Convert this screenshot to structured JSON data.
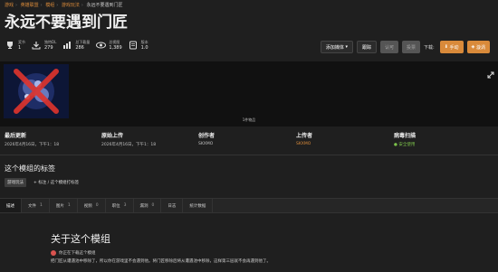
{
  "breadcrumb": [
    "游戏",
    "英雄联盟",
    "模组",
    "游戏玩法",
    "永远不要遇到门匠"
  ],
  "title": "永远不要遇到门匠",
  "stats": [
    {
      "icon": "trophy-icon",
      "label": "奖节",
      "value": "1"
    },
    {
      "icon": "download-icon",
      "label": "独特DL",
      "value": "279"
    },
    {
      "icon": "chart-icon",
      "label": "总下载量",
      "value": "286"
    },
    {
      "icon": "eye-icon",
      "label": "总视图",
      "value": "1,389"
    },
    {
      "icon": "version-icon",
      "label": "版本",
      "value": "1.0"
    }
  ],
  "actions": {
    "add_collection": "添加媒体",
    "tracking": "跟踪",
    "endorse": "认可",
    "vote": "投票",
    "download_label": "下载:",
    "manual": "手动",
    "vortex": "漩涡"
  },
  "hero": {
    "image_count": "1件物品"
  },
  "meta": {
    "last_updated": {
      "label": "最后更新",
      "value": "2026年4月16日，下午1：18"
    },
    "original_upload": {
      "label": "原始上传",
      "value": "2026年4月16日，下午1：18"
    },
    "created_by": {
      "label": "创作者",
      "value": "SKXMO"
    },
    "uploaded_by": {
      "label": "上传者",
      "value": "SKXMO"
    },
    "virus_scan": {
      "label": "病毒扫描",
      "value": "安全使用"
    }
  },
  "tags": {
    "heading": "这个模组的标签",
    "items": [
      "游戏玩法"
    ],
    "add_label": "+ 标注 / 这个模组打标签"
  },
  "tabs": [
    {
      "label": "描述",
      "count": ""
    },
    {
      "label": "文件",
      "count": "1"
    },
    {
      "label": "图片",
      "count": "1"
    },
    {
      "label": "视频",
      "count": "0"
    },
    {
      "label": "职位",
      "count": "3"
    },
    {
      "label": "漏洞",
      "count": "0"
    },
    {
      "label": "日志",
      "count": ""
    },
    {
      "label": "统计数据",
      "count": ""
    }
  ],
  "about": {
    "heading": "关于这个模组",
    "notice": "你正在下载这个模组",
    "description": "把门匠从遭遇池中移除了，所以你在游戏里不会遇到他。将门匠移除后将从遭遇池中移除，这样第三层就不会再遇到他了。"
  },
  "colors": {
    "accent": "#d98a3a",
    "background": "#1f1f1f",
    "success": "#7cc24a"
  }
}
